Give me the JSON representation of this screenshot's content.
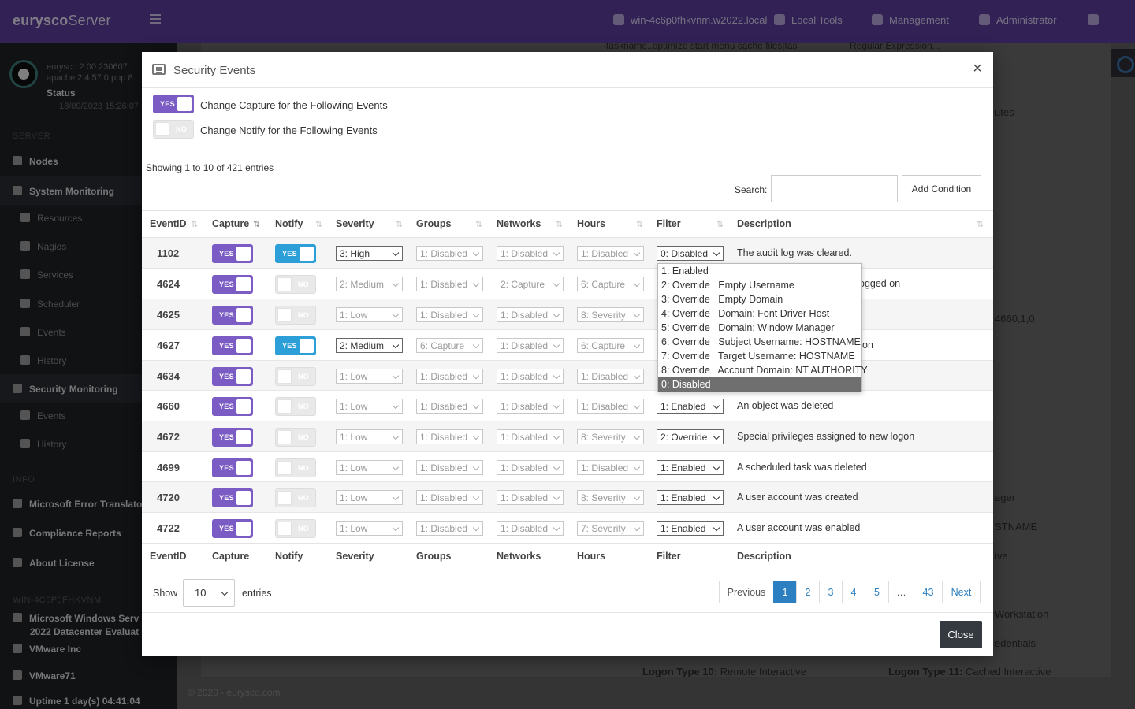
{
  "app": {
    "brand_bold": "eurysco",
    "brand_light": "Server",
    "top_nav": [
      {
        "label": "win-4c6p0fhkvnm.w2022.local"
      },
      {
        "label": "Local Tools"
      },
      {
        "label": "Management"
      },
      {
        "label": "Administrator"
      }
    ],
    "sidebar": {
      "version": "eurysco 2.00.230607",
      "stack": "apache 2.4.57.0 php 8.",
      "status": "Status",
      "date": "18/09/2023 15:26:07",
      "server_head": "SERVER",
      "nodes": "Nodes",
      "system_monitoring": "System Monitoring",
      "sys_items": [
        "Resources",
        "Nagios",
        "Services",
        "Scheduler",
        "Events",
        "History"
      ],
      "security_monitoring": "Security Monitoring",
      "sec_items": [
        "Events",
        "History"
      ],
      "info_head": "INFO",
      "info_items": [
        "Microsoft Error Translato",
        "Compliance Reports",
        "About License"
      ],
      "host_head": "WIN-4C6P0FHKVNM",
      "host_os": "Microsoft Windows Serv",
      "host_os2": "2022 Datacenter Evaluat",
      "vendor": "VMware Inc",
      "model": "VMware71",
      "uptime": "Uptime 1 day(s) 04:41:04"
    },
    "background_fragments": {
      "filter_text": "-taskname..optimize start menu cache files|tas",
      "regex_placeholder": "Regular Expression...",
      "minutes": "utes",
      "frag_a": "4660,1,0",
      "frag_b": "ager",
      "frag_c": "STNAME",
      "frag_d": "ive",
      "frag_e": "Workstation",
      "frag_f": "edentials",
      "logon10_label": "Logon Type 10:",
      "logon10_value": "Remote Interactive",
      "logon11_label": "Logon Type 11:",
      "logon11_value": "Cached Interactive",
      "copyright": "© 2020 - eurysco.com"
    }
  },
  "modal": {
    "title": "Security Events",
    "close_glyph": "×",
    "capture_toggle": {
      "state": "YES",
      "label": "Change Capture for the Following Events"
    },
    "notify_toggle": {
      "state": "NO",
      "label": "Change Notify for the Following Events"
    },
    "showing": "Showing 1 to 10 of 421 entries",
    "search_label": "Search:",
    "search_value": "",
    "add_condition": "Add Condition",
    "columns": [
      "EventID",
      "Capture",
      "Notify",
      "Severity",
      "Groups",
      "Networks",
      "Hours",
      "Filter",
      "Description"
    ],
    "rows": [
      {
        "id": "1102",
        "capture": "YES",
        "notify": "YES",
        "severity": "3: High",
        "groups": "1: Disabled",
        "networks": "1: Disabled",
        "hours": "1: Disabled",
        "filter": "0: Disabled",
        "description": "The audit log was cleared."
      },
      {
        "id": "4624",
        "capture": "YES",
        "notify": "NO",
        "severity": "2: Medium",
        "groups": "1: Disabled",
        "networks": "2: Capture",
        "hours": "6: Capture",
        "filter": "",
        "description": "ogged on"
      },
      {
        "id": "4625",
        "capture": "YES",
        "notify": "NO",
        "severity": "1: Low",
        "groups": "1: Disabled",
        "networks": "1: Disabled",
        "hours": "8: Severity",
        "filter": "",
        "description": ""
      },
      {
        "id": "4627",
        "capture": "YES",
        "notify": "YES",
        "severity": "2: Medium",
        "groups": "6: Capture",
        "networks": "1: Disabled",
        "hours": "6: Capture",
        "filter": "",
        "description": "on"
      },
      {
        "id": "4634",
        "capture": "YES",
        "notify": "NO",
        "severity": "1: Low",
        "groups": "1: Disabled",
        "networks": "1: Disabled",
        "hours": "1: Disabled",
        "filter": "",
        "description": ""
      },
      {
        "id": "4660",
        "capture": "YES",
        "notify": "NO",
        "severity": "1: Low",
        "groups": "1: Disabled",
        "networks": "1: Disabled",
        "hours": "1: Disabled",
        "filter": "1: Enabled",
        "description": "An object was deleted"
      },
      {
        "id": "4672",
        "capture": "YES",
        "notify": "NO",
        "severity": "1: Low",
        "groups": "1: Disabled",
        "networks": "1: Disabled",
        "hours": "8: Severity",
        "filter": "2: Override",
        "description": "Special privileges assigned to new logon"
      },
      {
        "id": "4699",
        "capture": "YES",
        "notify": "NO",
        "severity": "1: Low",
        "groups": "1: Disabled",
        "networks": "1: Disabled",
        "hours": "1: Disabled",
        "filter": "1: Enabled",
        "description": "A scheduled task was deleted"
      },
      {
        "id": "4720",
        "capture": "YES",
        "notify": "NO",
        "severity": "1: Low",
        "groups": "1: Disabled",
        "networks": "1: Disabled",
        "hours": "8: Severity",
        "filter": "1: Enabled",
        "description": "A user account was created"
      },
      {
        "id": "4722",
        "capture": "YES",
        "notify": "NO",
        "severity": "1: Low",
        "groups": "1: Disabled",
        "networks": "1: Disabled",
        "hours": "7: Severity",
        "filter": "1: Enabled",
        "description": "A user account was enabled"
      }
    ],
    "filter_dropdown": {
      "options": [
        "1: Enabled",
        "2: Override   Empty Username",
        "3: Override   Empty Domain",
        "4: Override   Domain: Font Driver Host",
        "5: Override   Domain: Window Manager",
        "6: Override   Subject Username: HOSTNAME",
        "7: Override   Target Username: HOSTNAME",
        "8: Override   Account Domain: NT AUTHORITY",
        "0: Disabled"
      ],
      "selected": "0: Disabled"
    },
    "show_label": "Show",
    "page_length": "10",
    "entries_label": "entries",
    "pagination": [
      "Previous",
      "1",
      "2",
      "3",
      "4",
      "5",
      "…",
      "43",
      "Next"
    ],
    "active_page": "1",
    "close_button": "Close"
  },
  "colors": {
    "accent_purple": "#7b5cc4",
    "notify_blue": "#2c9fd8",
    "link_blue": "#2c7fc0",
    "close_dark": "#343a40"
  }
}
